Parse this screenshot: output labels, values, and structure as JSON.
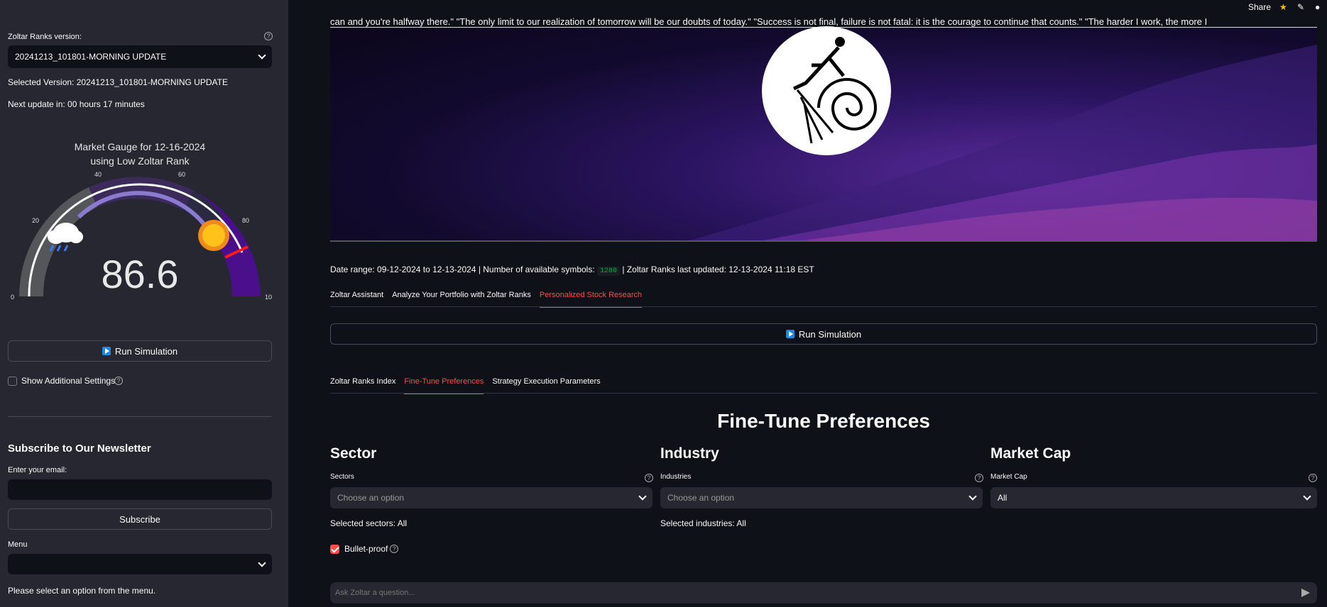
{
  "sidebar": {
    "version_label": "Zoltar Ranks version:",
    "version_value": "20241213_101801-MORNING UPDATE",
    "selected_version": "Selected Version: 20241213_101801-MORNING UPDATE",
    "next_update": "Next update in: 00 hours 17 minutes",
    "gauge": {
      "title_line1": "Market Gauge for 12-16-2024",
      "title_line2": "using Low Zoltar Rank",
      "value": 86.6,
      "value_text": "86.6",
      "ticks": [
        "0",
        "20",
        "40",
        "60",
        "80",
        "10"
      ]
    },
    "run_simulation": "Run Simulation",
    "show_settings": "Show Additional Settings",
    "newsletter_title": "Subscribe to Our Newsletter",
    "email_label": "Enter your email:",
    "email_value": "",
    "subscribe": "Subscribe",
    "menu_label": "Menu",
    "menu_value": "",
    "menu_hint": "Please select an option from the menu."
  },
  "topbar": {
    "share": "Share"
  },
  "banner": {
    "marquee": "can and you're halfway there.\"     \"The only limit to our realization of tomorrow will be our doubts of today.\"     \"Success is not final, failure is not fatal: it is the courage to continue that counts.\"     \"The harder I work, the more I"
  },
  "meta": {
    "prefix": "Date range: 09-12-2024 to 12-13-2024 | Number of available symbols:",
    "symbols": "1280",
    "suffix": "| Zoltar Ranks last updated: 12-13-2024 11:18 EST"
  },
  "main_tabs": [
    "Zoltar Assistant",
    "Analyze Your Portfolio with Zoltar Ranks",
    "Personalized Stock Research"
  ],
  "run_simulation": "Run Simulation",
  "sub_tabs": [
    "Zoltar Ranks Index",
    "Fine-Tune Preferences",
    "Strategy Execution Parameters"
  ],
  "fine_tune": {
    "heading": "Fine-Tune Preferences",
    "sector": {
      "title": "Sector",
      "label": "Sectors",
      "placeholder": "Choose an option",
      "selected": "Selected sectors: All"
    },
    "industry": {
      "title": "Industry",
      "label": "Industries",
      "placeholder": "Choose an option",
      "selected": "Selected industries: All"
    },
    "market_cap": {
      "title": "Market Cap",
      "label": "Market Cap",
      "value": "All"
    },
    "bullet_proof": "Bullet-proof"
  },
  "chat": {
    "placeholder": "Ask Zoltar a question..."
  },
  "colors": {
    "accent": "#ff4b4b",
    "sidebar": "#262730",
    "bg": "#0e1117"
  }
}
